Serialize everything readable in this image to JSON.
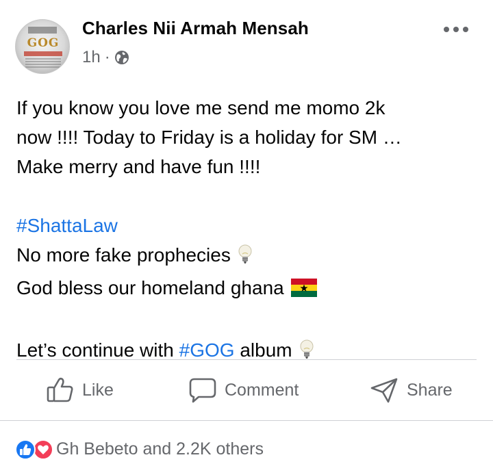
{
  "post": {
    "author": "Charles Nii Armah Mensah",
    "timestamp": "1h",
    "separator": "·",
    "privacy_icon": "globe-icon",
    "more_icon": "more-dots-icon",
    "avatar_text": "GOG",
    "text": {
      "line1": "If you know you love me send me momo 2k",
      "line2": "now !!!! Today to Friday is a holiday for SM …",
      "line3": "Make merry and have fun !!!!",
      "hashtag1": "#ShattaLaw",
      "line5": "No more fake prophecies",
      "line6": "God bless our homeland ghana",
      "line8_before": "Let’s continue with ",
      "hashtag2": "#GOG",
      "line8_after": " album"
    },
    "emojis": [
      "light-bulb-icon",
      "ghana-flag-icon",
      "light-bulb-icon"
    ]
  },
  "actions": {
    "like_label": "Like",
    "comment_label": "Comment",
    "share_label": "Share"
  },
  "reactions": {
    "summary": "Gh Bebeto and 2.2K others",
    "types": [
      "like",
      "love"
    ]
  },
  "colors": {
    "hashtag": "#1b74e4",
    "secondary_text": "#65676b",
    "like_reaction": "#1877f2",
    "love_reaction": "#f33e58"
  }
}
